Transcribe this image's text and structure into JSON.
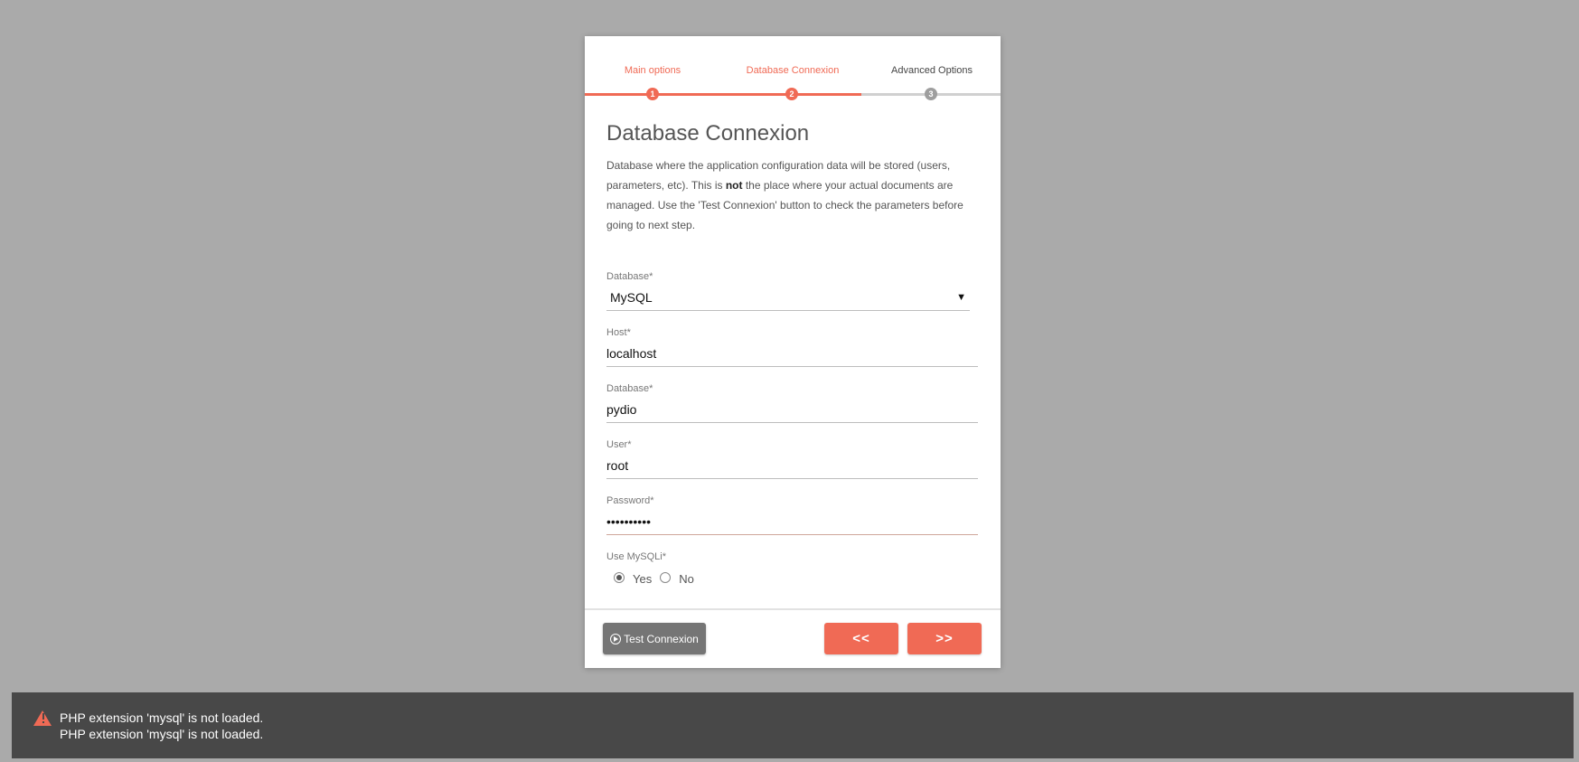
{
  "stepper": {
    "steps": [
      {
        "label": "Main options",
        "number": "1",
        "state": "done"
      },
      {
        "label": "Database Connexion",
        "number": "2",
        "state": "active"
      },
      {
        "label": "Advanced Options",
        "number": "3",
        "state": "pending"
      }
    ]
  },
  "page": {
    "title": "Database Connexion",
    "desc_part1": "Database where the application configuration data will be stored (users, parameters, etc). This is ",
    "desc_bold": "not",
    "desc_part2": " the place where your actual documents are managed. Use the 'Test Connexion' button to check the parameters before going to next step."
  },
  "form": {
    "db_type": {
      "label": "Database*",
      "value": "MySQL",
      "arrow": "▼"
    },
    "host": {
      "label": "Host*",
      "value": "localhost"
    },
    "database": {
      "label": "Database*",
      "value": "pydio"
    },
    "user": {
      "label": "User*",
      "value": "root"
    },
    "password": {
      "label": "Password*",
      "value": "••••••••••"
    },
    "mysqli": {
      "label": "Use MySQLi*",
      "yes": "Yes",
      "no": "No",
      "selected": "Yes"
    }
  },
  "footer": {
    "test_label": "Test Connexion",
    "prev_label": "<<",
    "next_label": ">>"
  },
  "snackbar": {
    "line1": "PHP extension 'mysql' is not loaded.",
    "line2": "PHP extension 'mysql' is not loaded."
  },
  "colors": {
    "accent": "#f06a55",
    "background": "#aaaaaa",
    "snackbar": "#484848"
  }
}
